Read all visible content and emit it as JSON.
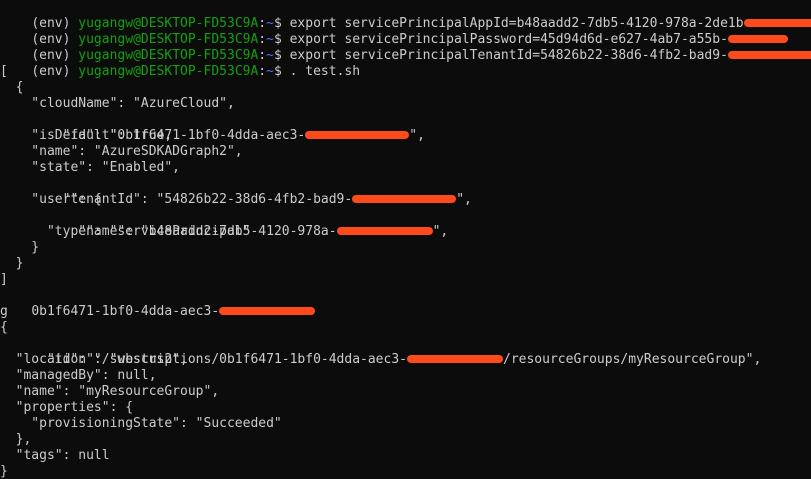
{
  "colors": {
    "background": "#0c0c0c",
    "text": "#cccccc",
    "prompt_user": "#13a10e",
    "prompt_path": "#3b78ff",
    "redaction": "#ff4a1c"
  },
  "prompt": {
    "env": "(env) ",
    "user_host": "yugangw@DESKTOP-FD53C9A",
    "sep": ":",
    "path": "~",
    "symbol": "$ "
  },
  "lines": [
    {
      "type": "prompt",
      "cmd": "export servicePrincipalAppId=b48aadd2-7db5-4120-978a-2de1b",
      "redacted": true
    },
    {
      "type": "prompt",
      "cmd": "export servicePrincipalPassword=45d94d6d-e627-4ab7-a55b-",
      "redacted": true
    },
    {
      "type": "prompt",
      "cmd": "export servicePrincipalTenantId=54826b22-38d6-4fb2-bad9-",
      "redacted": true
    },
    {
      "type": "prompt",
      "cmd": ". test.sh",
      "redacted": false
    },
    {
      "type": "out",
      "text": "["
    },
    {
      "type": "out",
      "text": "  {"
    },
    {
      "type": "out",
      "text": "    \"cloudName\": \"AzureCloud\","
    },
    {
      "type": "out",
      "text": "    \"id\": \"0b1f6471-1bf0-4dda-aec3-",
      "redacted": true,
      "after": "\","
    },
    {
      "type": "out",
      "text": "    \"isDefault\": true,"
    },
    {
      "type": "out",
      "text": "    \"name\": \"AzureSDKADGraph2\","
    },
    {
      "type": "out",
      "text": "    \"state\": \"Enabled\","
    },
    {
      "type": "out",
      "text": "    \"tenantId\": \"54826b22-38d6-4fb2-bad9-",
      "redacted": true,
      "after": "\","
    },
    {
      "type": "out",
      "text": "    \"user\": {"
    },
    {
      "type": "out",
      "text": "      \"name\": \"b48aadd2-7db5-4120-978a-",
      "redacted": true,
      "after": "\","
    },
    {
      "type": "out",
      "text": "      \"type\": \"servicePrincipal\""
    },
    {
      "type": "out",
      "text": "    }"
    },
    {
      "type": "out",
      "text": "  }"
    },
    {
      "type": "out",
      "text": "]"
    },
    {
      "type": "out",
      "text": "0b1f6471-1bf0-4dda-aec3-",
      "redacted": true,
      "after": ""
    },
    {
      "type": "out",
      "text": "g"
    },
    {
      "type": "out",
      "text": "{"
    },
    {
      "type": "out",
      "text": "  \"id\": \"/subscriptions/0b1f6471-1bf0-4dda-aec3-",
      "redacted": true,
      "after": "/resourceGroups/myResourceGroup\","
    },
    {
      "type": "out",
      "text": "  \"location\": \"westus2\","
    },
    {
      "type": "out",
      "text": "  \"managedBy\": null,"
    },
    {
      "type": "out",
      "text": "  \"name\": \"myResourceGroup\","
    },
    {
      "type": "out",
      "text": "  \"properties\": {"
    },
    {
      "type": "out",
      "text": "    \"provisioningState\": \"Succeeded\""
    },
    {
      "type": "out",
      "text": "  },"
    },
    {
      "type": "out",
      "text": "  \"tags\": null"
    },
    {
      "type": "out",
      "text": "}"
    }
  ]
}
